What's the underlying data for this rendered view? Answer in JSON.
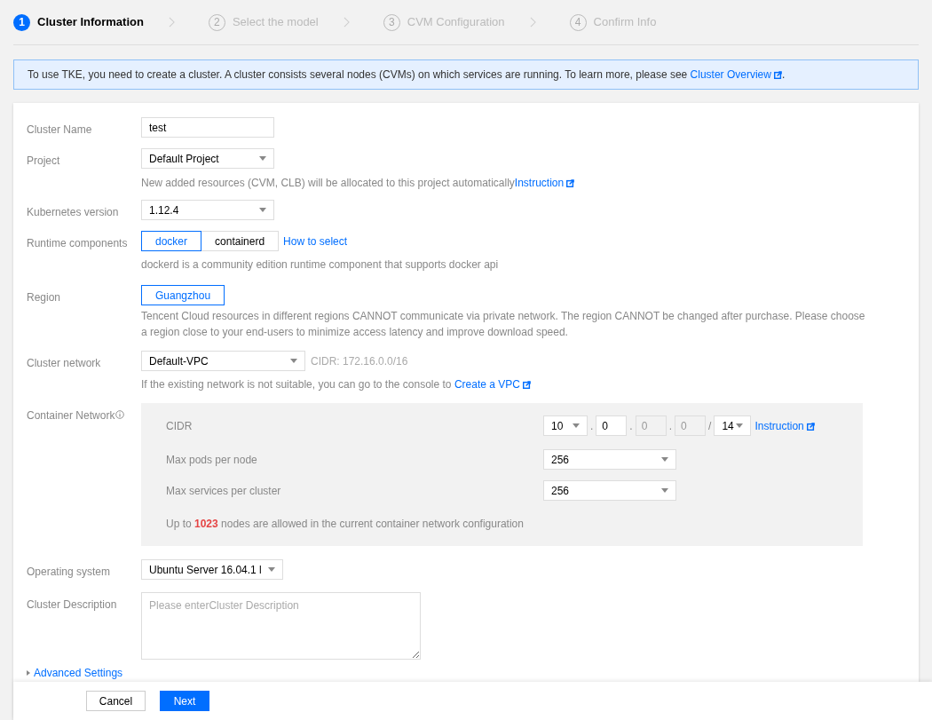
{
  "steps": [
    {
      "number": "1",
      "label": "Cluster Information",
      "selected": true
    },
    {
      "number": "2",
      "label": "Select the model",
      "selected": false
    },
    {
      "number": "3",
      "label": "CVM Configuration",
      "selected": false
    },
    {
      "number": "4",
      "label": "Confirm Info",
      "selected": false
    }
  ],
  "banner": {
    "text": "To use TKE, you need to create a cluster. A cluster consists several nodes (CVMs) on which services are running. To learn more, please see ",
    "link": "Cluster Overview",
    "suffix": "."
  },
  "form": {
    "cluster_name": {
      "label": "Cluster Name",
      "value": "test"
    },
    "project": {
      "label": "Project",
      "value": "Default Project",
      "hint": "New added resources (CVM, CLB) will be allocated to this project automatically",
      "hint_link": "Instruction"
    },
    "kubernetes_version": {
      "label": "Kubernetes version",
      "value": "1.12.4"
    },
    "runtime": {
      "label": "Runtime components",
      "options": [
        {
          "label": "docker",
          "selected": true
        },
        {
          "label": "containerd",
          "selected": false
        }
      ],
      "link": "How to select",
      "hint": "dockerd is a community edition runtime component that supports docker api"
    },
    "region": {
      "label": "Region",
      "options": [
        {
          "label": "Guangzhou",
          "selected": true
        }
      ],
      "hint": "Tencent Cloud resources in different regions CANNOT communicate via private network. The region CANNOT be changed after purchase. Please choose a region close to your end-users to minimize access latency and improve download speed."
    },
    "cluster_network": {
      "label": "Cluster network",
      "value": "Default-VPC",
      "cidr": "CIDR: 172.16.0.0/16",
      "hint": "If the existing network is not suitable, you can go to the console to ",
      "hint_link": "Create a VPC"
    },
    "container_network": {
      "label": "Container Network",
      "cidr_label": "CIDR",
      "octets": [
        {
          "value": "10",
          "kind": "select"
        },
        {
          "value": "0",
          "kind": "input"
        },
        {
          "value": "0",
          "kind": "disabled"
        },
        {
          "value": "0",
          "kind": "disabled"
        }
      ],
      "separators": [
        ".",
        ".",
        ".",
        "/"
      ],
      "mask": "14",
      "link": "Instruction",
      "max_pods_label": "Max pods per node",
      "max_pods": "256",
      "max_services_label": "Max services per cluster",
      "max_services": "256",
      "summary": "Up to **1023** nodes are allowed in the current container network configuration"
    },
    "operating_system": {
      "label": "Operating system",
      "value": "Ubuntu Server 16.04.1 l"
    },
    "description": {
      "label": "Cluster Description",
      "placeholder": "Please enterCluster Description"
    },
    "advanced": {
      "label": "Advanced Settings"
    }
  },
  "footer": {
    "buttons": [
      {
        "label": "Cancel",
        "kind": "secondary"
      },
      {
        "label": "Next",
        "kind": "primary"
      }
    ]
  }
}
